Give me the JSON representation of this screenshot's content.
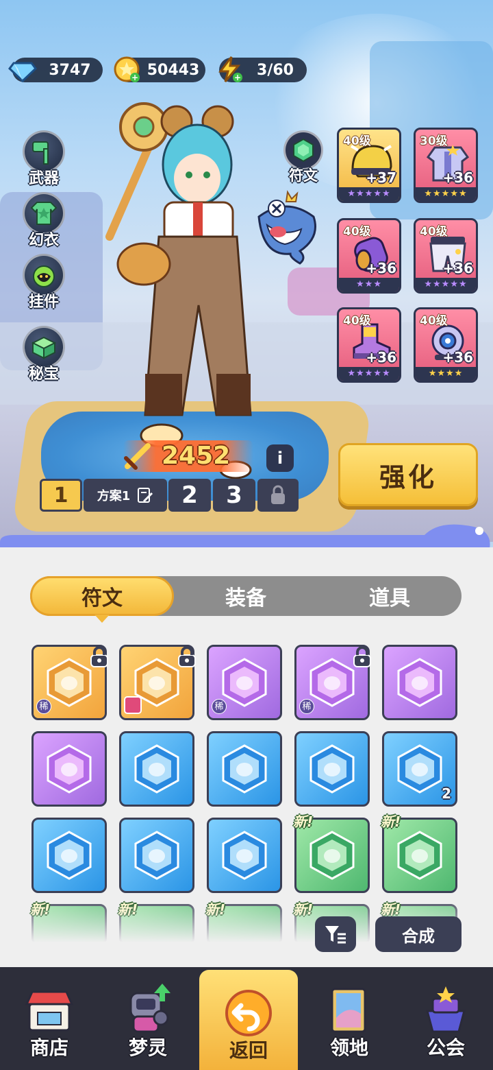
{
  "currencies": {
    "diamond": {
      "value": "3747",
      "icon": "diamond-icon"
    },
    "gold": {
      "value": "50443",
      "icon": "gold-coin-icon"
    },
    "energy": {
      "value": "3/60",
      "icon": "lightning-icon"
    }
  },
  "left_menu": [
    {
      "label": "武器",
      "icon": "hammer-icon"
    },
    {
      "label": "幻衣",
      "icon": "shirt-icon"
    },
    {
      "label": "挂件",
      "icon": "pendant-icon"
    },
    {
      "label": "秘宝",
      "icon": "treasure-icon"
    }
  ],
  "rune_button": {
    "label": "符文",
    "icon": "rune-icon"
  },
  "equipment": [
    {
      "level": "40级",
      "plus": "+37",
      "stars": "★★★★★",
      "icon": "helmet-icon",
      "color": "gold"
    },
    {
      "level": "30级",
      "plus": "+36",
      "stars": "★★★★★",
      "icon": "armor-icon",
      "color": "pink"
    },
    {
      "level": "40级",
      "plus": "+36",
      "stars": "★★★",
      "icon": "bracer-icon",
      "color": "pink"
    },
    {
      "level": "40级",
      "plus": "+36",
      "stars": "★★★★★",
      "icon": "pants-icon",
      "color": "pink"
    },
    {
      "level": "40级",
      "plus": "+36",
      "stars": "★★★★★",
      "icon": "boots-icon",
      "color": "pink"
    },
    {
      "level": "40级",
      "plus": "+36",
      "stars": "★★★★",
      "icon": "orb-icon",
      "color": "pink"
    }
  ],
  "power": {
    "value": "2452",
    "icon": "sword-icon"
  },
  "info_label": "i",
  "plans": {
    "active": "1",
    "name": "方案1",
    "slot2": "2",
    "slot3": "3"
  },
  "enhance_label": "强化",
  "tabs": [
    "符文",
    "装备",
    "道具"
  ],
  "items": [
    {
      "rarity": "gold",
      "tag": "稀",
      "locked": true,
      "new": false,
      "count": ""
    },
    {
      "rarity": "gold",
      "tag": "",
      "avatar": true,
      "locked": true,
      "new": false,
      "count": ""
    },
    {
      "rarity": "purple",
      "tag": "稀",
      "locked": false,
      "new": false,
      "count": ""
    },
    {
      "rarity": "purple",
      "tag": "稀",
      "locked": true,
      "new": false,
      "count": ""
    },
    {
      "rarity": "purple",
      "tag": "",
      "locked": false,
      "new": false,
      "count": ""
    },
    {
      "rarity": "purple",
      "tag": "",
      "locked": false,
      "new": false,
      "count": ""
    },
    {
      "rarity": "blue",
      "tag": "",
      "locked": false,
      "new": false,
      "count": ""
    },
    {
      "rarity": "blue",
      "tag": "",
      "locked": false,
      "new": false,
      "count": ""
    },
    {
      "rarity": "blue",
      "tag": "",
      "locked": false,
      "new": false,
      "count": ""
    },
    {
      "rarity": "blue",
      "tag": "",
      "locked": false,
      "new": false,
      "count": "2"
    },
    {
      "rarity": "blue",
      "tag": "",
      "locked": false,
      "new": false,
      "count": ""
    },
    {
      "rarity": "blue",
      "tag": "",
      "locked": false,
      "new": false,
      "count": ""
    },
    {
      "rarity": "blue",
      "tag": "",
      "locked": false,
      "new": false,
      "count": ""
    },
    {
      "rarity": "green",
      "tag": "",
      "locked": false,
      "new": true,
      "count": ""
    },
    {
      "rarity": "green",
      "tag": "",
      "locked": false,
      "new": true,
      "count": ""
    }
  ],
  "new_label": "新!",
  "synth_label": "合成",
  "filter_icon": "filter-icon",
  "bottom_nav": [
    {
      "label": "商店",
      "icon": "shop-icon"
    },
    {
      "label": "梦灵",
      "icon": "robot-icon"
    },
    {
      "label": "返回",
      "icon": "back-arrow-icon"
    },
    {
      "label": "领地",
      "icon": "territory-icon"
    },
    {
      "label": "公会",
      "icon": "guild-icon"
    }
  ],
  "colors": {
    "accent_gold": "#f5bf38",
    "dark": "#3b3f55",
    "panel": "#efefef"
  }
}
